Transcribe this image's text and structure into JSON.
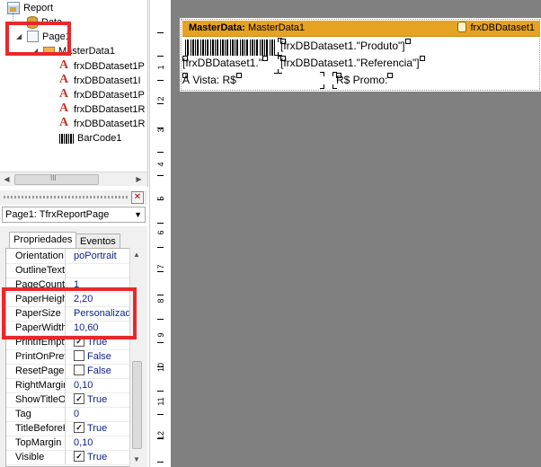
{
  "tree": {
    "items": [
      {
        "label": "Report",
        "icon": "report-icon"
      },
      {
        "label": "Data",
        "icon": "data-icon"
      },
      {
        "label": "Page1",
        "icon": "page-icon"
      },
      {
        "label": "MasterData1",
        "icon": "band-icon"
      },
      {
        "label": "frxDBDataset1P",
        "icon": "text-memo-icon"
      },
      {
        "label": "frxDBDataset1I",
        "icon": "text-memo-icon"
      },
      {
        "label": "frxDBDataset1P",
        "icon": "text-memo-icon"
      },
      {
        "label": "frxDBDataset1R",
        "icon": "text-memo-icon"
      },
      {
        "label": "frxDBDataset1R",
        "icon": "text-memo-icon"
      },
      {
        "label": "BarCode1",
        "icon": "barcode-icon"
      }
    ],
    "scroll_grip": "III"
  },
  "inspector": {
    "selected_object": "Page1: TfrxReportPage",
    "tabs": [
      {
        "label": "Propriedades",
        "active": true
      },
      {
        "label": "Eventos",
        "active": false
      }
    ],
    "properties": [
      {
        "name": "Orientation",
        "value": "poPortrait"
      },
      {
        "name": "OutlineText",
        "value": ""
      },
      {
        "name": "PageCount",
        "value": "1"
      },
      {
        "name": "PaperHeight",
        "value": "2,20"
      },
      {
        "name": "PaperSize",
        "value": "Personalizado"
      },
      {
        "name": "PaperWidth",
        "value": "10,60"
      },
      {
        "name": "PrintIfEmpty",
        "value": "True",
        "checked": true
      },
      {
        "name": "PrintOnPrevious",
        "value": "False",
        "checked": false
      },
      {
        "name": "ResetPageNumbers",
        "value": "False",
        "checked": false
      },
      {
        "name": "RightMargin",
        "value": "0,10"
      },
      {
        "name": "ShowTitleOnPreviousPage",
        "value": "True",
        "checked": true
      },
      {
        "name": "Tag",
        "value": "0"
      },
      {
        "name": "TitleBeforeHeader",
        "value": "True",
        "checked": true
      },
      {
        "name": "TopMargin",
        "value": "0,10"
      },
      {
        "name": "Visible",
        "value": "True",
        "checked": true
      }
    ]
  },
  "ruler": {
    "numbers": [
      "1",
      "2",
      "3",
      "4",
      "5",
      "6",
      "7",
      "8",
      "9",
      "10",
      "11",
      "12"
    ]
  },
  "design": {
    "band": {
      "title_bold": "MasterData:",
      "title_name": "MasterData1",
      "dataset": "frxDBDataset1"
    },
    "memos": [
      {
        "text": "[frxDBDataset1.\"Produto\"]"
      },
      {
        "text": "[frxDBDataset1.\""
      },
      {
        "text": "[frxDBDataset1.\"Referencia\"]"
      },
      {
        "text": "À Vista: R$"
      },
      {
        "text": "R$ Promo:"
      }
    ]
  },
  "colors": {
    "highlight_red": "#e8282c",
    "band_orange": "#e6a321",
    "design_bg": "#808080",
    "value_blue": "#0b1f8f"
  }
}
